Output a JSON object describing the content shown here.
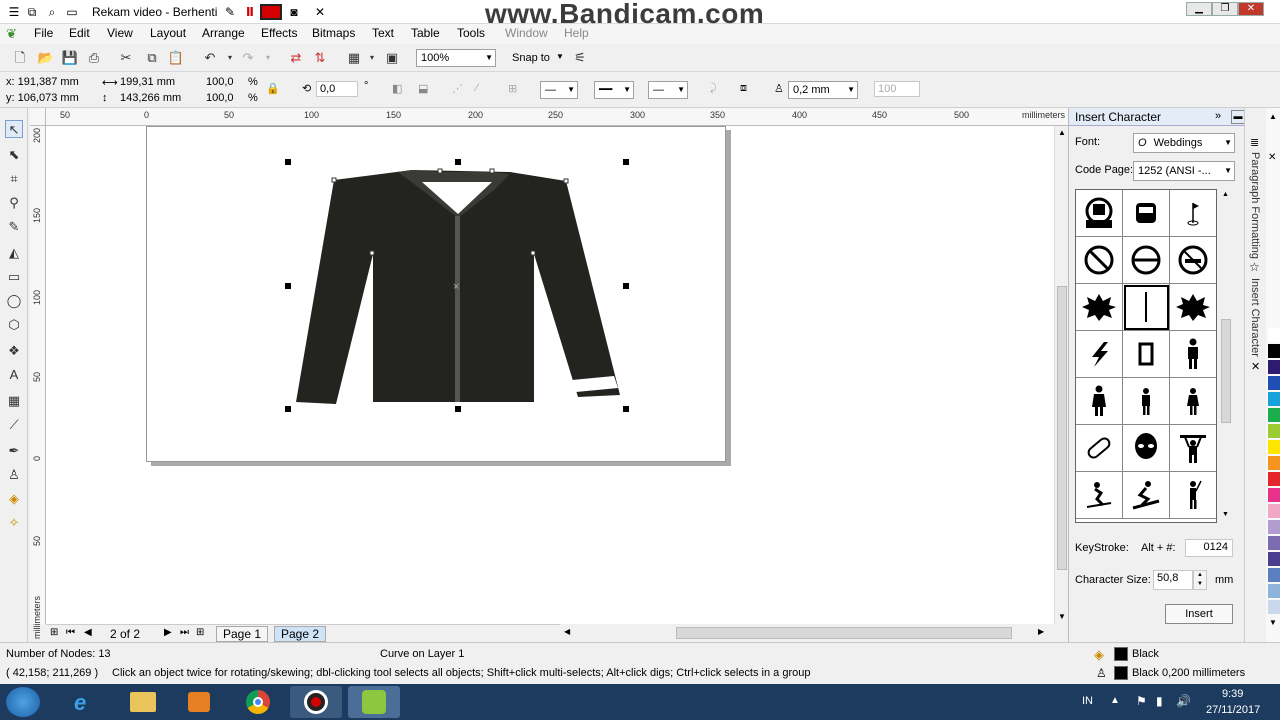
{
  "titlebar": {
    "title": "Rekam video - Berhenti",
    "watermark": "www.Bandicam.com"
  },
  "menu": [
    "File",
    "Edit",
    "View",
    "Layout",
    "Arrange",
    "Effects",
    "Bitmaps",
    "Text",
    "Table",
    "Tools",
    "Window",
    "Help"
  ],
  "toolbar": {
    "zoom": "100%",
    "snap": "Snap to"
  },
  "property_bar": {
    "x": "x: 191,387 mm",
    "y": "y: 106,073 mm",
    "w": "199,31 mm",
    "h": "143,266 mm",
    "sx": "100,0",
    "sy": "100,0",
    "pct1": "%",
    "pct2": "%",
    "rotation": "0,0",
    "deg": "°",
    "outline_width": "0,2 mm",
    "ratio": "100"
  },
  "ruler": {
    "top_labels": [
      "50",
      "0",
      "50",
      "100",
      "150",
      "200",
      "250",
      "300",
      "350",
      "400",
      "450",
      "500"
    ],
    "units": "millimeters",
    "left_labels": [
      "200",
      "150",
      "100",
      "50",
      "0",
      "50"
    ]
  },
  "pages": {
    "counter": "2 of 2",
    "page1": "Page 1",
    "page2": "Page 2"
  },
  "docker": {
    "title": "Insert Character",
    "font_label": "Font:",
    "font_value": "Webdings",
    "codepage_label": "Code Page:",
    "codepage_value": "1252  (ANSI -...",
    "keystroke_label": "KeyStroke:",
    "keystroke_prefix": "Alt + #:",
    "keystroke_value": "0124",
    "charsize_label": "Character Size:",
    "charsize_value": "50,8",
    "charsize_unit": "mm",
    "insert_label": "Insert"
  },
  "side_tabs": [
    "Paragraph Formatting",
    "Insert Character"
  ],
  "status": {
    "nodes": "Number of Nodes: 13",
    "layer": "Curve on Layer 1",
    "coords": "( 42,158; 211,269 )",
    "hint": "Click an object twice for rotating/skewing; dbl-clicking tool selects all objects; Shift+click multi-selects; Alt+click digs; Ctrl+click selects in a group",
    "fill": "Black",
    "outline": "Black  0,200 millimeters"
  },
  "taskbar": {
    "lang": "IN",
    "time": "9:39",
    "date": "27/11/2017"
  },
  "colors": {
    "jacket": "#23231f",
    "collar": "#3a3a36",
    "accent_titlebar": "#d40000",
    "palette": [
      "#ffffff",
      "#000000",
      "#2e1a6e",
      "#1f4fb5",
      "#17a3d9",
      "#1bae4d",
      "#9ccc30",
      "#ffe600",
      "#f7941d",
      "#e4262b",
      "#e8328a",
      "#f2a7c6",
      "#b39dd0",
      "#7c6bb0",
      "#4a3f8e",
      "#5b7fbf",
      "#8fb4d9",
      "#c9d8ea"
    ]
  }
}
